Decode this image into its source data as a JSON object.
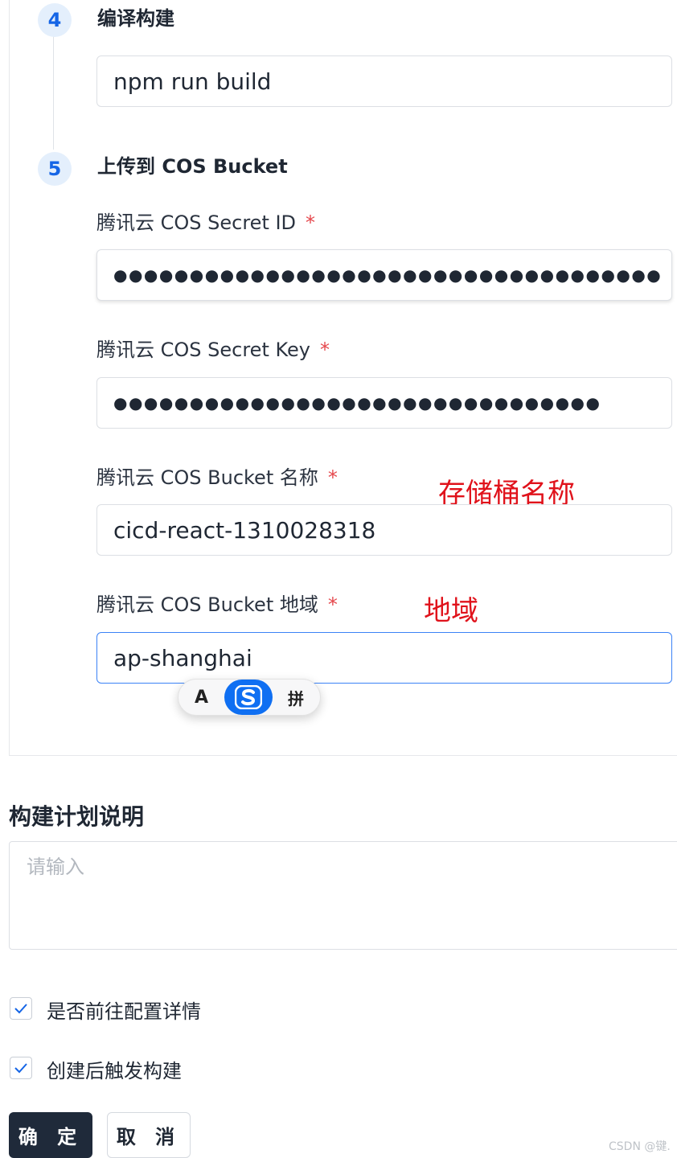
{
  "steps": [
    {
      "number": "4",
      "title": "编译构建",
      "value": "npm run build"
    },
    {
      "number": "5",
      "title": "上传到 COS Bucket"
    }
  ],
  "fields": {
    "secret_id": {
      "label": "腾讯云 COS Secret ID",
      "value": "●●●●●●●●●●●●●●●●●●●●●●●●●●●●●●●●●●●●",
      "required": "*"
    },
    "secret_key": {
      "label": "腾讯云 COS Secret Key",
      "value": "●●●●●●●●●●●●●●●●●●●●●●●●●●●●●●●●",
      "required": "*"
    },
    "bucket_name": {
      "label": "腾讯云 COS Bucket 名称",
      "value": "cicd-react-1310028318",
      "required": "*"
    },
    "bucket_region": {
      "label": "腾讯云 COS Bucket 地域",
      "value": "ap-shanghai",
      "required": "*"
    }
  },
  "annotations": {
    "bucket_name": "存储桶名称",
    "bucket_region": "地域"
  },
  "ime": {
    "left": "A",
    "right": "拼",
    "icon": "sogou-icon"
  },
  "plan_description": {
    "title": "构建计划说明",
    "placeholder": "请输入"
  },
  "checkboxes": [
    {
      "label": "是否前往配置详情",
      "checked": true
    },
    {
      "label": "创建后触发构建",
      "checked": true
    }
  ],
  "buttons": {
    "confirm": "确 定",
    "cancel": "取 消"
  },
  "watermark": "CSDN @键.",
  "colors": {
    "accent": "#1565e6",
    "required": "#e5484d",
    "annotation": "#e0121b",
    "primary_button": "#1f2a3a",
    "focus_border": "#3b82f6"
  }
}
